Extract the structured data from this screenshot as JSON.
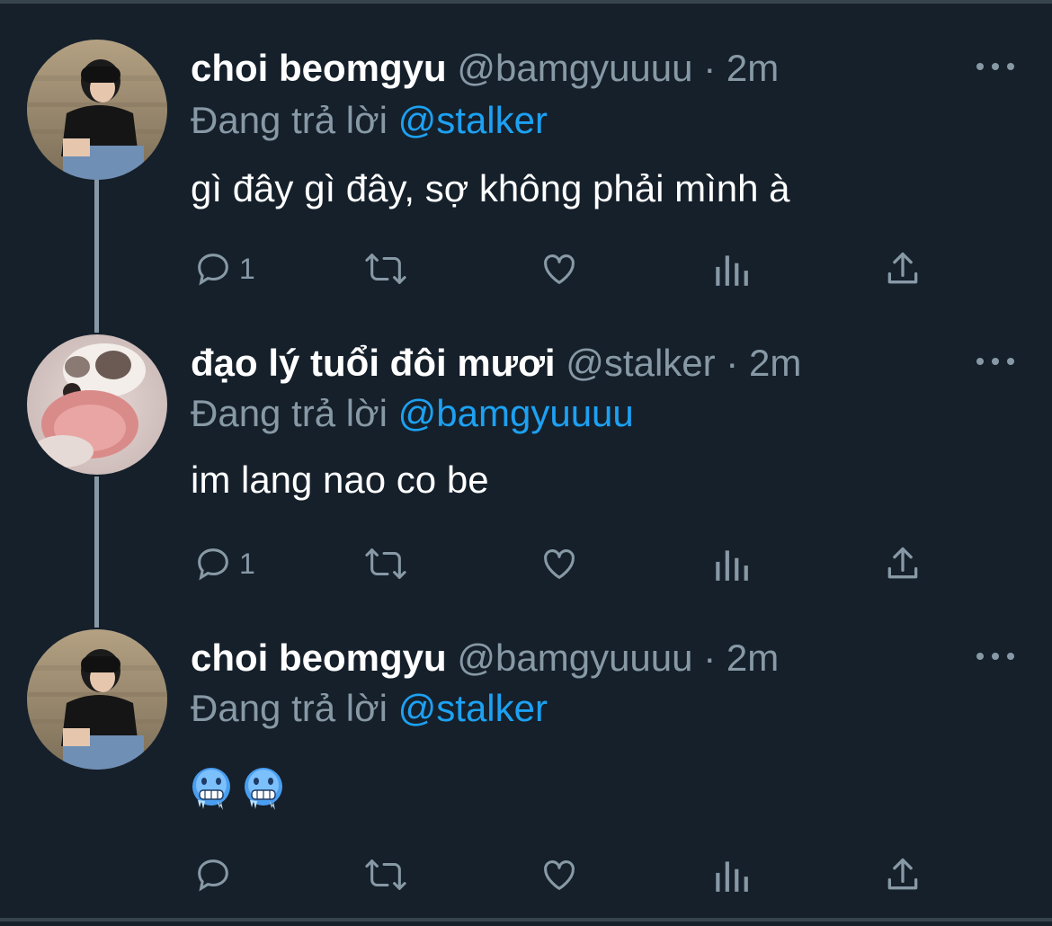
{
  "thread": [
    {
      "name": "choi beomgyu",
      "handle": "@bamgyuuuu",
      "separator": "·",
      "time": "2m",
      "reply_label": "Đang trả lời",
      "reply_to": "@stalker",
      "text": "gì đây gì đây, sợ không phải mình à",
      "emoji": [],
      "reply_count": "1",
      "avatar": "avatar-photo-person"
    },
    {
      "name": "đạo lý tuổi đôi mươi",
      "handle": "@stalker",
      "separator": "·",
      "time": "2m",
      "reply_label": "Đang trả lời",
      "reply_to": "@bamgyuuuu",
      "text": "im lang nao co be",
      "emoji": [],
      "reply_count": "1",
      "avatar": "avatar-hamster"
    },
    {
      "name": "choi beomgyu",
      "handle": "@bamgyuuuu",
      "separator": "·",
      "time": "2m",
      "reply_label": "Đang trả lời",
      "reply_to": "@stalker",
      "text": "",
      "emoji": [
        "cold-face-emoji",
        "cold-face-emoji"
      ],
      "reply_count": "",
      "avatar": "avatar-photo-person"
    }
  ],
  "icons": {
    "reply": "reply-icon",
    "retweet": "retweet-icon",
    "like": "like-icon",
    "analytics": "analytics-icon",
    "share": "share-icon",
    "more": "more-icon"
  },
  "colors": {
    "background": "#15202b",
    "primary_text": "#ffffff",
    "secondary_text": "#8899a6",
    "accent": "#1da1f2"
  }
}
